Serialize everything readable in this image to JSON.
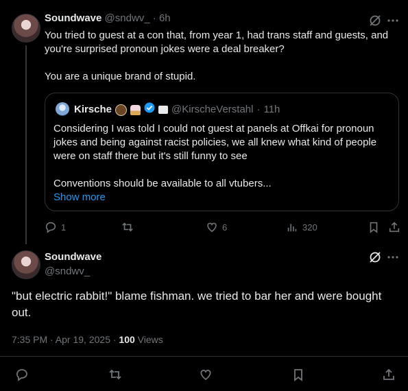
{
  "reply": {
    "author_name": "Soundwave",
    "handle": "@sndwv_",
    "separator": "·",
    "time": "6h",
    "text_line1": "You tried to guest at a con that, from year 1, had trans staff and guests, and",
    "text_line2": "you're surprised pronoun jokes were a deal breaker?",
    "text_line3": "You are a unique brand of stupid.",
    "quote": {
      "author_name": "Kirsche",
      "handle": "@KirscheVerstahl",
      "separator": "·",
      "time": "11h",
      "text_line1": "Considering I was told I could not guest at panels at Offkai for pronoun",
      "text_line2": "jokes and being against racist policies, we all knew what kind of people",
      "text_line3": "were on staff there but it's still funny to see",
      "text_line4": "Conventions should be available to all vtubers...",
      "show_more": "Show more"
    },
    "actions": {
      "replies": "1",
      "likes": "6",
      "views": "320"
    }
  },
  "main": {
    "author_name": "Soundwave",
    "handle": "@sndwv_",
    "text_line1": "\"but electric rabbit!\" blame fishman. we tried to bar her and were bought",
    "text_line2": "out.",
    "timestamp": "7:35 PM · Apr 19, 2025 · ",
    "views_count": "100",
    "views_label": " Views"
  },
  "icons": {
    "grok": "grok-icon",
    "more": "more-icon",
    "reply": "reply-icon",
    "retweet": "retweet-icon",
    "like": "like-icon",
    "views": "views-icon",
    "bookmark": "bookmark-icon",
    "share": "share-icon",
    "verified": "verified-badge-icon",
    "accent": "#1d9bf0"
  }
}
